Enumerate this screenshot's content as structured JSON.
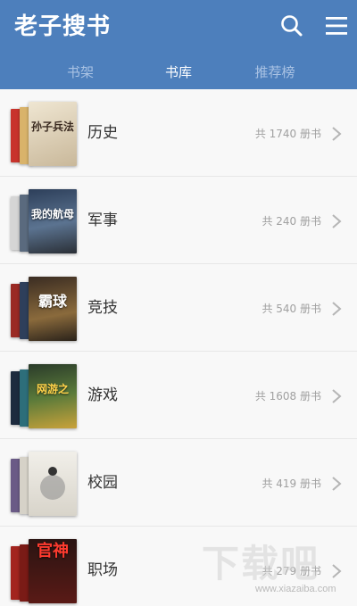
{
  "header": {
    "brand": "老子搜书",
    "search_icon": "search-icon",
    "menu_icon": "menu-icon",
    "bg_color": "#4d7fbc"
  },
  "tabs": [
    {
      "label": "书架",
      "active": false
    },
    {
      "label": "书库",
      "active": true
    },
    {
      "label": "推荐榜",
      "active": false
    }
  ],
  "categories": [
    {
      "name": "历史",
      "count": "共 1740 册书",
      "cover_text": "孙子兵法",
      "cover_colors": [
        "#c8332c",
        "#d9b36a",
        "#e8dcc3"
      ]
    },
    {
      "name": "军事",
      "count": "共 240 册书",
      "cover_text": "我的航母",
      "cover_colors": [
        "#3b4f6b",
        "#8a8a8a",
        "#2d3f5a"
      ]
    },
    {
      "name": "竞技",
      "count": "共 540 册书",
      "cover_text": "霸球",
      "cover_colors": [
        "#9a2a24",
        "#2e3f5b",
        "#4b3a2a"
      ]
    },
    {
      "name": "游戏",
      "count": "共 1608 册书",
      "cover_text": "网游之",
      "cover_colors": [
        "#1d2b3e",
        "#2d6e7a",
        "#3d4a2c"
      ]
    },
    {
      "name": "校园",
      "count": "共 419 册书",
      "cover_text": "",
      "cover_colors": [
        "#6a5a86",
        "#d6d2c8",
        "#e9e7e1"
      ]
    },
    {
      "name": "职场",
      "count": "共 279 册书",
      "cover_text": "官神",
      "cover_colors": [
        "#a3241f",
        "#7a1b16",
        "#b8211b"
      ]
    }
  ],
  "watermark": {
    "main": "下载吧",
    "url": "www.xiazaiba.com"
  }
}
